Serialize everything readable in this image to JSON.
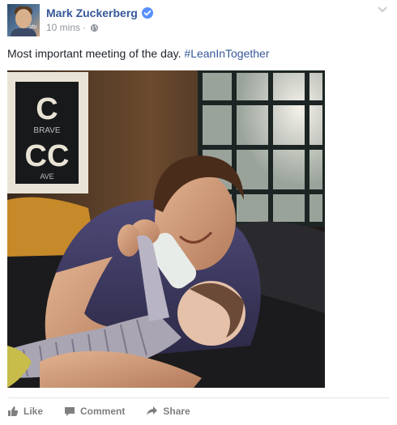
{
  "post": {
    "author": "Mark Zuckerberg",
    "timestamp": "10 mins",
    "separator": "·",
    "text": "Most important meeting of the day. ",
    "hashtag": "#LeanInTogether",
    "icons": {
      "verified": "verified-badge-icon",
      "audience": "globe-icon",
      "menu": "chevron-down-icon"
    },
    "photo": {
      "sign_letters": [
        "C",
        "BRAVE",
        "CC",
        "AVE"
      ]
    }
  },
  "avatar": {
    "text": "stu"
  },
  "actions": {
    "like": "Like",
    "comment": "Comment",
    "share": "Share"
  },
  "colors": {
    "link_blue": "#365899",
    "verified_blue": "#5890ff",
    "meta_gray": "#90949c",
    "action_gray": "#7f7f7f"
  }
}
